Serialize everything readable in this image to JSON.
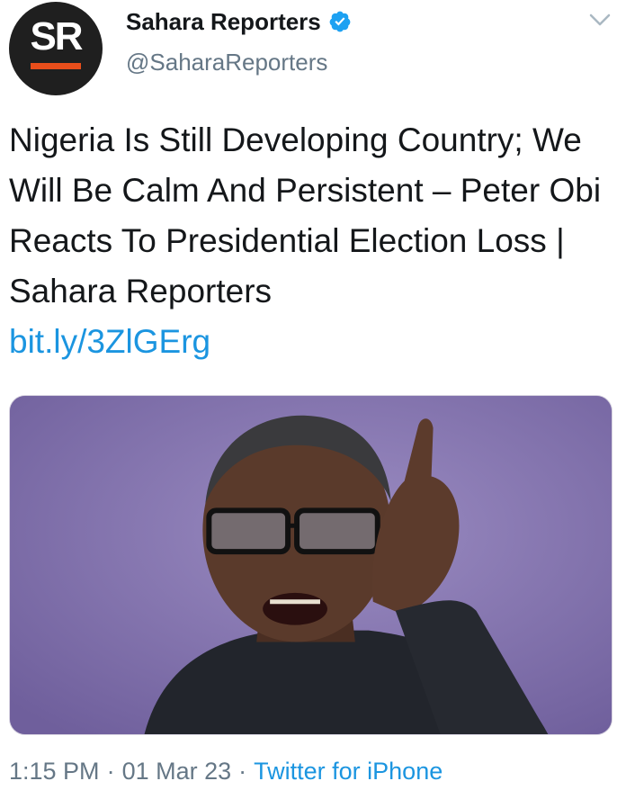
{
  "author": {
    "display_name": "Sahara Reporters",
    "handle": "@SaharaReporters",
    "avatar_text": "SR",
    "verified_icon": "verified-badge-icon"
  },
  "tweet": {
    "text": "Nigeria Is Still Developing Country; We Will Be Calm And Persistent – Peter Obi Reacts To Presidential Election Loss | Sahara Reporters",
    "link": "bit.ly/3ZlGErg"
  },
  "media": {
    "type": "photo",
    "description_icon": "photo-icon"
  },
  "meta": {
    "time": "1:15 PM",
    "separator": "·",
    "date": "01 Mar 23",
    "source": "Twitter for iPhone"
  },
  "colors": {
    "link": "#1b95e0",
    "secondary_text": "#657786",
    "primary_text": "#14171a",
    "avatar_bg": "#1f1f1f",
    "avatar_accent": "#e94e1b"
  }
}
